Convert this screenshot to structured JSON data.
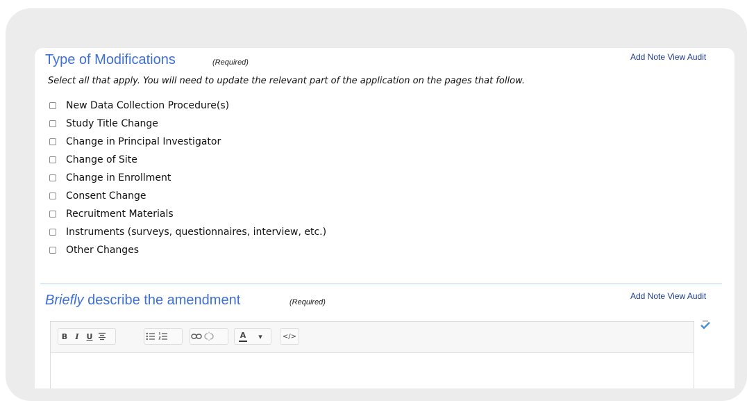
{
  "section1": {
    "title": "Type of Modifications",
    "required": "(Required)",
    "add_note": "Add Note",
    "view_audit": "View Audit",
    "instructions": "Select all that apply. You will need to update the relevant part of the application on the pages that follow.",
    "options": [
      {
        "label": "New Data Collection Procedure(s)",
        "checked": false
      },
      {
        "label": "Study Title Change",
        "checked": false
      },
      {
        "label": "Change in Principal Investigator",
        "checked": false
      },
      {
        "label": "Change of Site",
        "checked": false
      },
      {
        "label": "Change in Enrollment",
        "checked": false
      },
      {
        "label": "Consent Change",
        "checked": false
      },
      {
        "label": "Recruitment Materials",
        "checked": false
      },
      {
        "label": "Instruments (surveys, questionnaires, interview, etc.)",
        "checked": false
      },
      {
        "label": "Other Changes",
        "checked": false
      }
    ]
  },
  "section2": {
    "title_emphasis": "Briefly",
    "title_rest": " describe the amendment",
    "required": "(Required)",
    "add_note": "Add Note",
    "view_audit": "View Audit"
  },
  "editor": {
    "toolbar": {
      "bold": "B",
      "italic": "I",
      "underline": "U",
      "font_color": "A",
      "dropdown": "▾",
      "source": "</>"
    },
    "content": ""
  },
  "colors": {
    "accent": "#3d6fd6",
    "link": "#1b3a8a",
    "divider": "#a9cdf3"
  }
}
